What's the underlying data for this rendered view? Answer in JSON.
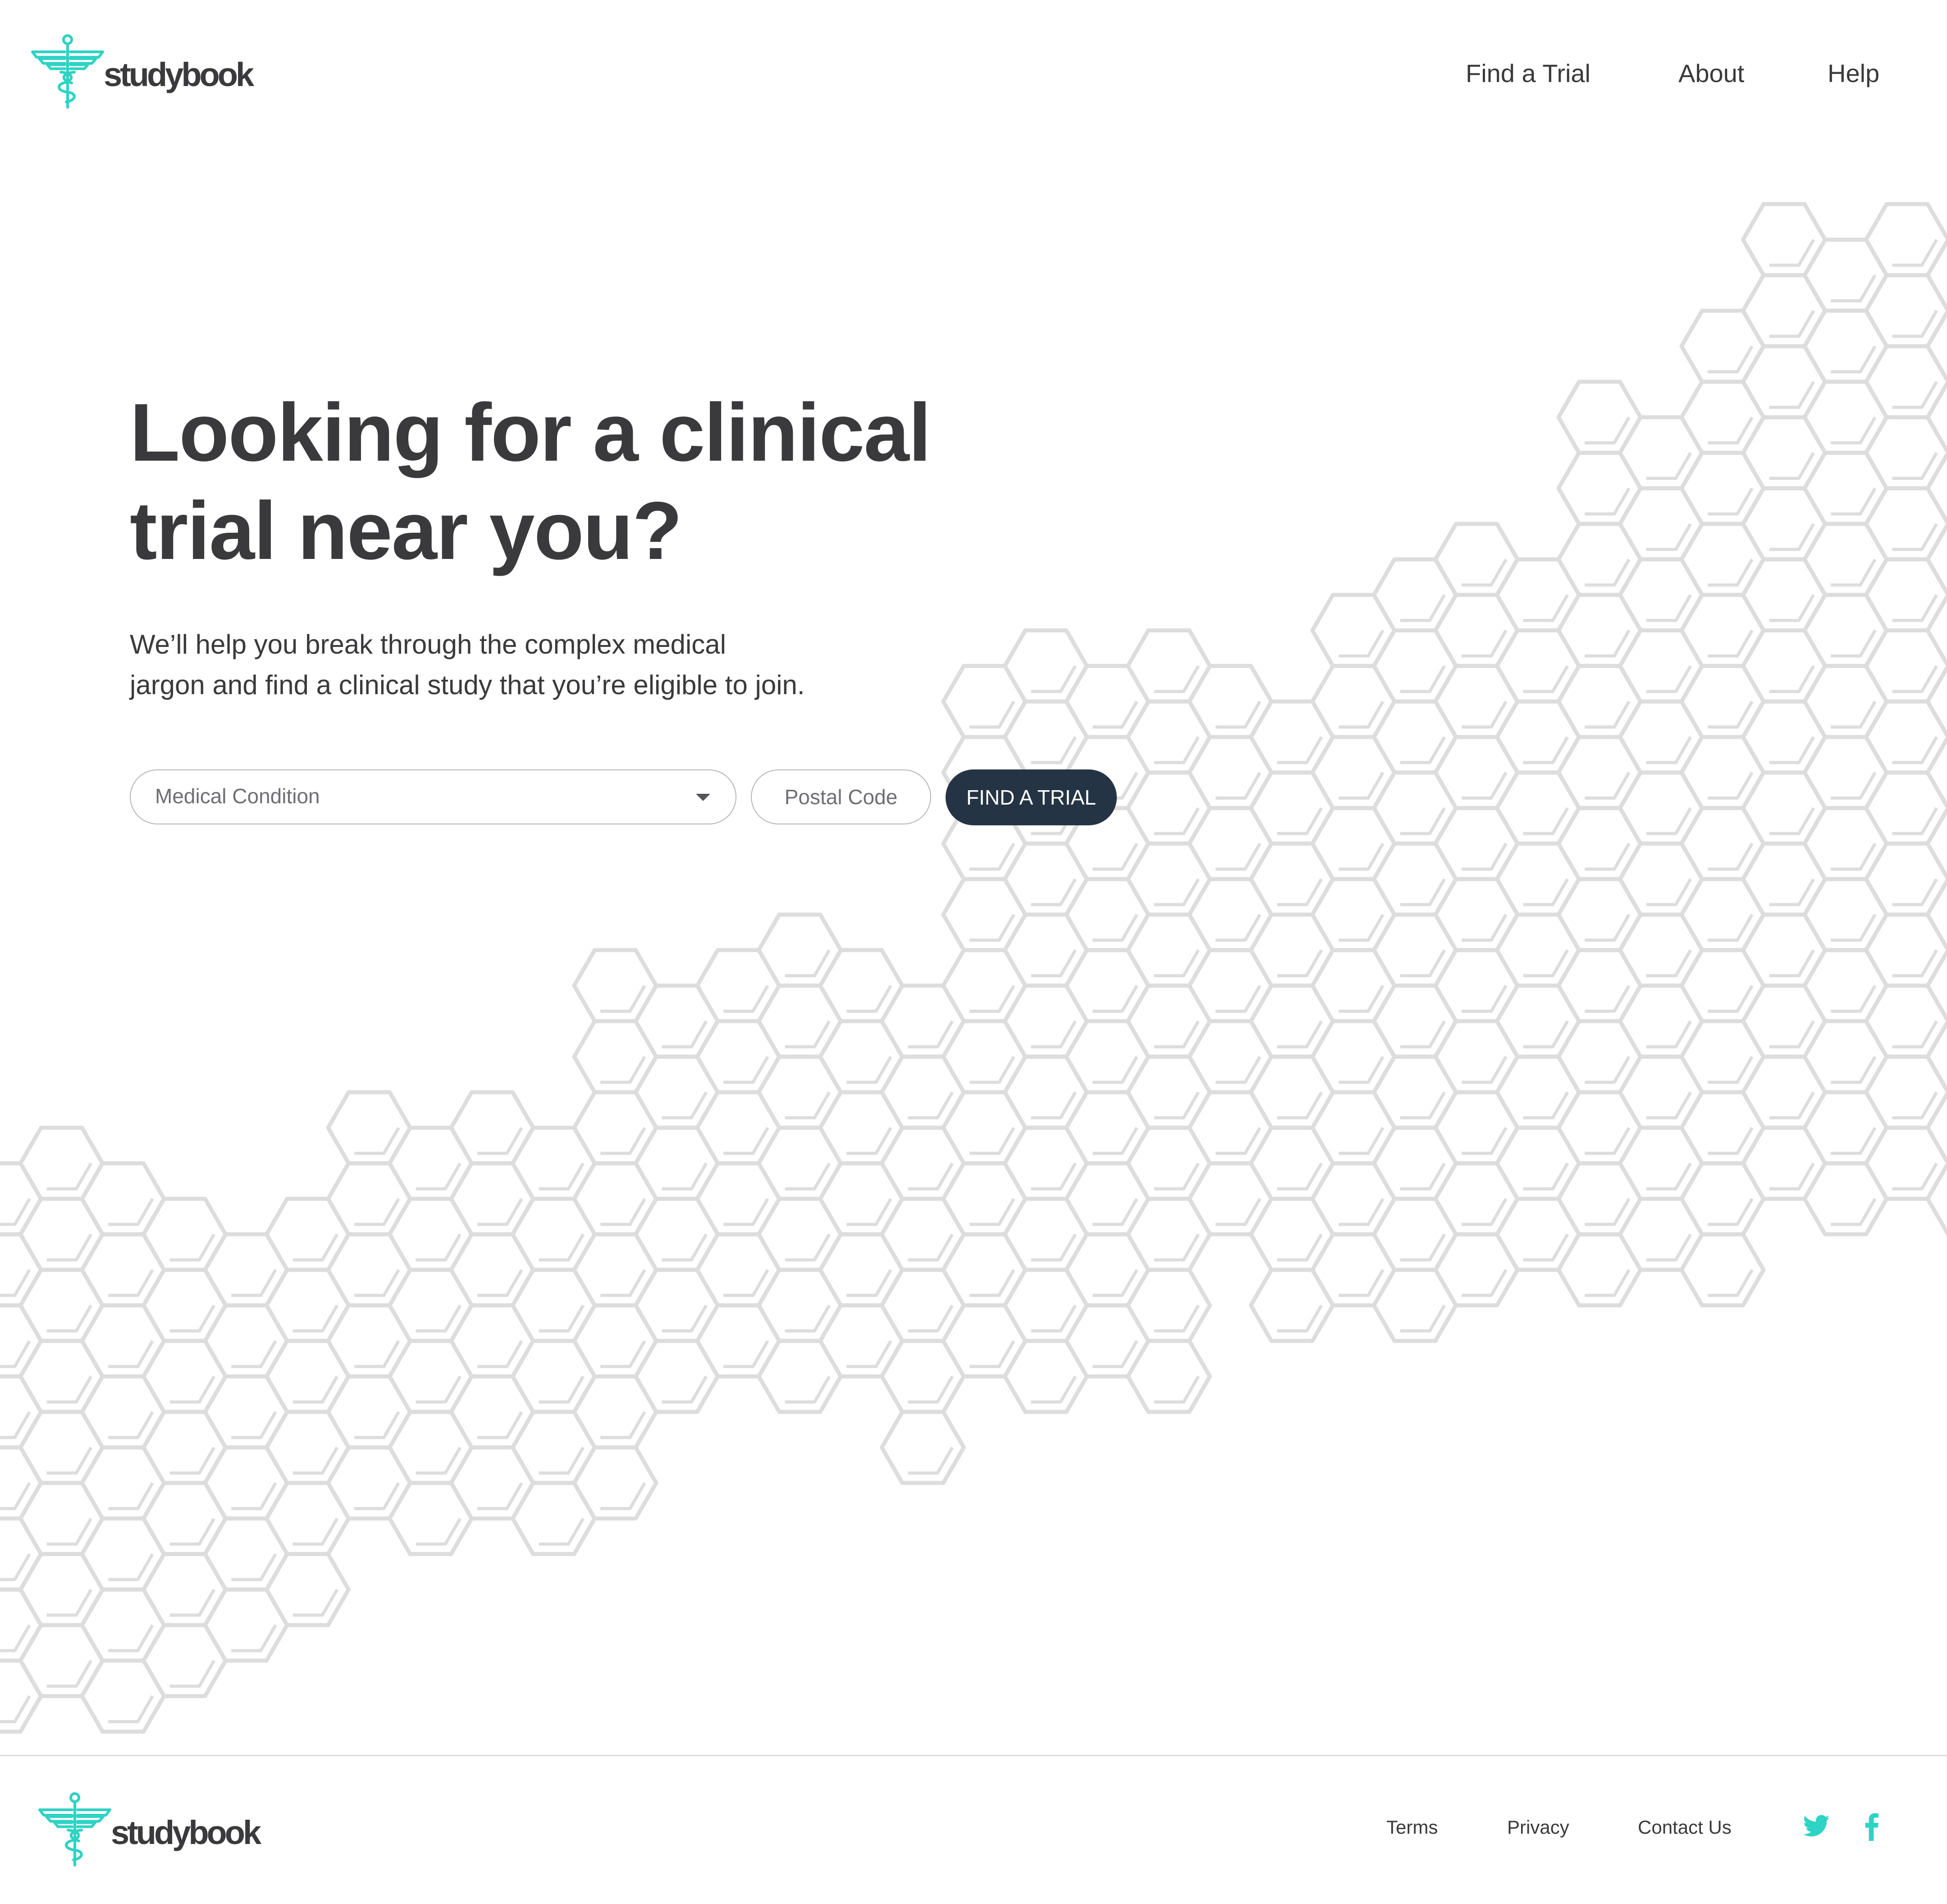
{
  "brand": {
    "name": "studybook",
    "logo_icon": "caduceus-icon",
    "accent_color": "#2ed3c4",
    "text_color": "#3a3a3c"
  },
  "nav": {
    "items": [
      {
        "label": "Find a Trial"
      },
      {
        "label": "About"
      },
      {
        "label": "Help"
      }
    ]
  },
  "hero": {
    "title_line1": "Looking for a clinical",
    "title_line2": "trial near you?",
    "subtitle_line1": "We’ll help you break through the complex medical",
    "subtitle_line2": "jargon and find a clinical study that you’re eligible to join."
  },
  "search": {
    "condition_placeholder": "Medical Condition",
    "condition_icon": "caret-down-icon",
    "postal_placeholder": "Postal Code",
    "button_label": "FIND A TRIAL",
    "button_color": "#253444"
  },
  "background": {
    "pattern": "hexagon-pattern",
    "stroke_color": "#dddddd"
  },
  "footer": {
    "links": [
      {
        "label": "Terms"
      },
      {
        "label": "Privacy"
      },
      {
        "label": "Contact Us"
      }
    ],
    "social": [
      {
        "icon": "twitter-icon"
      },
      {
        "icon": "facebook-icon"
      }
    ]
  }
}
